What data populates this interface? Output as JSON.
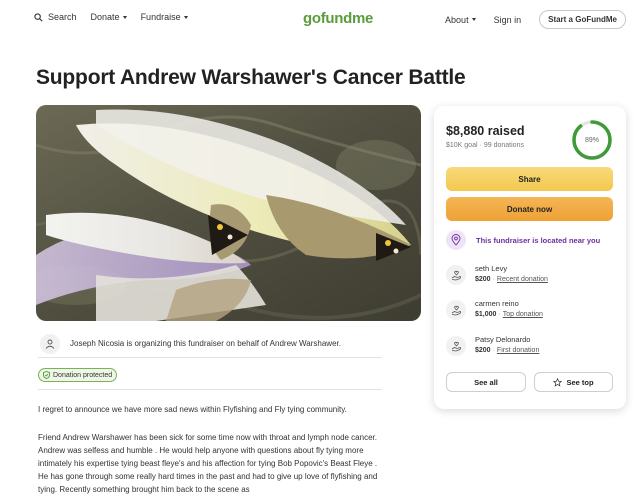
{
  "nav": {
    "search_label": "Search",
    "donate_label": "Donate",
    "fundraise_label": "Fundraise",
    "logo": "gofundme",
    "about_label": "About",
    "signin_label": "Sign in",
    "start_label": "Start a GoFundMe"
  },
  "campaign": {
    "title": "Support Andrew Warshawer's Cancer Battle",
    "organizer_text": "Joseph Nicosia is organizing this fundraiser on behalf of Andrew Warshawer.",
    "protected_label": "Donation protected",
    "story_p1": "I regret to announce we have more sad news within Flyfishing and Fly tying community.",
    "story_p2": "Friend Andrew Warshawer has been sick for some time now with throat and lymph node cancer. Andrew was selfess and humble . He would help anyone with questions about fly tying more intimately his expertise tying beast fleye's and his affection for tying Bob Popovic's Beast Fleye . He has gone through some really hard times in the past and had to give up love of flyfishing and tying. Recently something brought him back to the scene as"
  },
  "card": {
    "raised": "$8,880 raised",
    "goal": "$10K goal",
    "donations": "99 donations",
    "progress_label": "89%",
    "progress": 0.89,
    "share_label": "Share",
    "donate_label": "Donate now",
    "near_label": "This fundraiser is located near you",
    "donors": [
      {
        "name": "seth Levy",
        "amount": "$200",
        "tag": "Recent donation"
      },
      {
        "name": "carmen reino",
        "amount": "$1,000",
        "tag": "Top donation"
      },
      {
        "name": "Patsy Delonardo",
        "amount": "$200",
        "tag": "First donation"
      }
    ],
    "see_all_label": "See all",
    "see_top_label": "See top"
  },
  "colors": {
    "brand_green": "#5a9c3e",
    "share_yellow": "#f3c84e",
    "donate_orange": "#eea235",
    "near_purple": "#6b2fa0"
  }
}
